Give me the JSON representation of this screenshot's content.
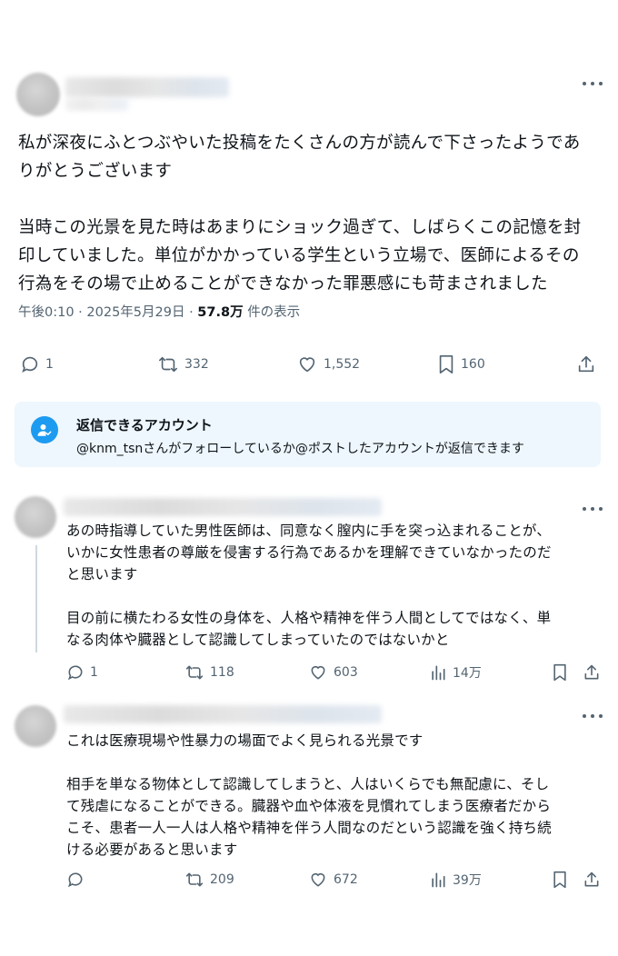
{
  "main_post": {
    "text": "私が深夜にふとつぶやいた投稿をたくさんの方が読んで下さったようであ\nりがとうございます\n\n当時この光景を見た時はあまりにショック過ぎて、しばらくこの記憶を封\n印していました。単位がかかっている学生という立場で、医師によるその\n行為をその場で止めることができなかった罪悪感にも苛まされました",
    "time": "午後0:10",
    "date": "2025年5月29日",
    "views_count": "57.8万",
    "views_label": "件の表示",
    "actions": {
      "replies": "1",
      "reposts": "332",
      "likes": "1,552",
      "bookmarks": "160"
    }
  },
  "reply_notice": {
    "title": "返信できるアカウント",
    "subtitle": "@knm_tsnさんがフォローしているか@ポストしたアカウントが返信できます"
  },
  "replies": [
    {
      "text": "あの時指導していた男性医師は、同意なく膣内に手を突っ込まれることが、\nいかに女性患者の尊厳を侵害する行為であるかを理解できていなかったのだ\nと思います\n\n目の前に横たわる女性の身体を、人格や精神を伴う人間としてではなく、単\nなる肉体や臓器として認識してしまっていたのではないかと",
      "actions": {
        "replies": "1",
        "reposts": "118",
        "likes": "603",
        "views": "14万"
      }
    },
    {
      "text": "これは医療現場や性暴力の場面でよく見られる光景です\n\n相手を単なる物体として認識してしまうと、人はいくらでも無配慮に、そし\nて残虐になることができる。臓器や血や体液を見慣れてしまう医療者だから\nこそ、患者一人一人は人格や精神を伴う人間なのだという認識を強く持ち続\nける必要があると思います",
      "actions": {
        "replies": "",
        "reposts": "209",
        "likes": "672",
        "views": "39万"
      }
    }
  ],
  "icons": {
    "reply": "speech-bubble-icon",
    "repost": "repost-arrows-icon",
    "like": "heart-icon",
    "bookmark": "bookmark-icon",
    "share": "share-upload-icon",
    "views": "bar-chart-icon",
    "more": "more-dots-icon",
    "notice": "person-check-icon"
  },
  "colors": {
    "text": "#0f1419",
    "muted": "#536471",
    "accent": "#1d9bf0",
    "notice_bg": "#eef7fd"
  }
}
